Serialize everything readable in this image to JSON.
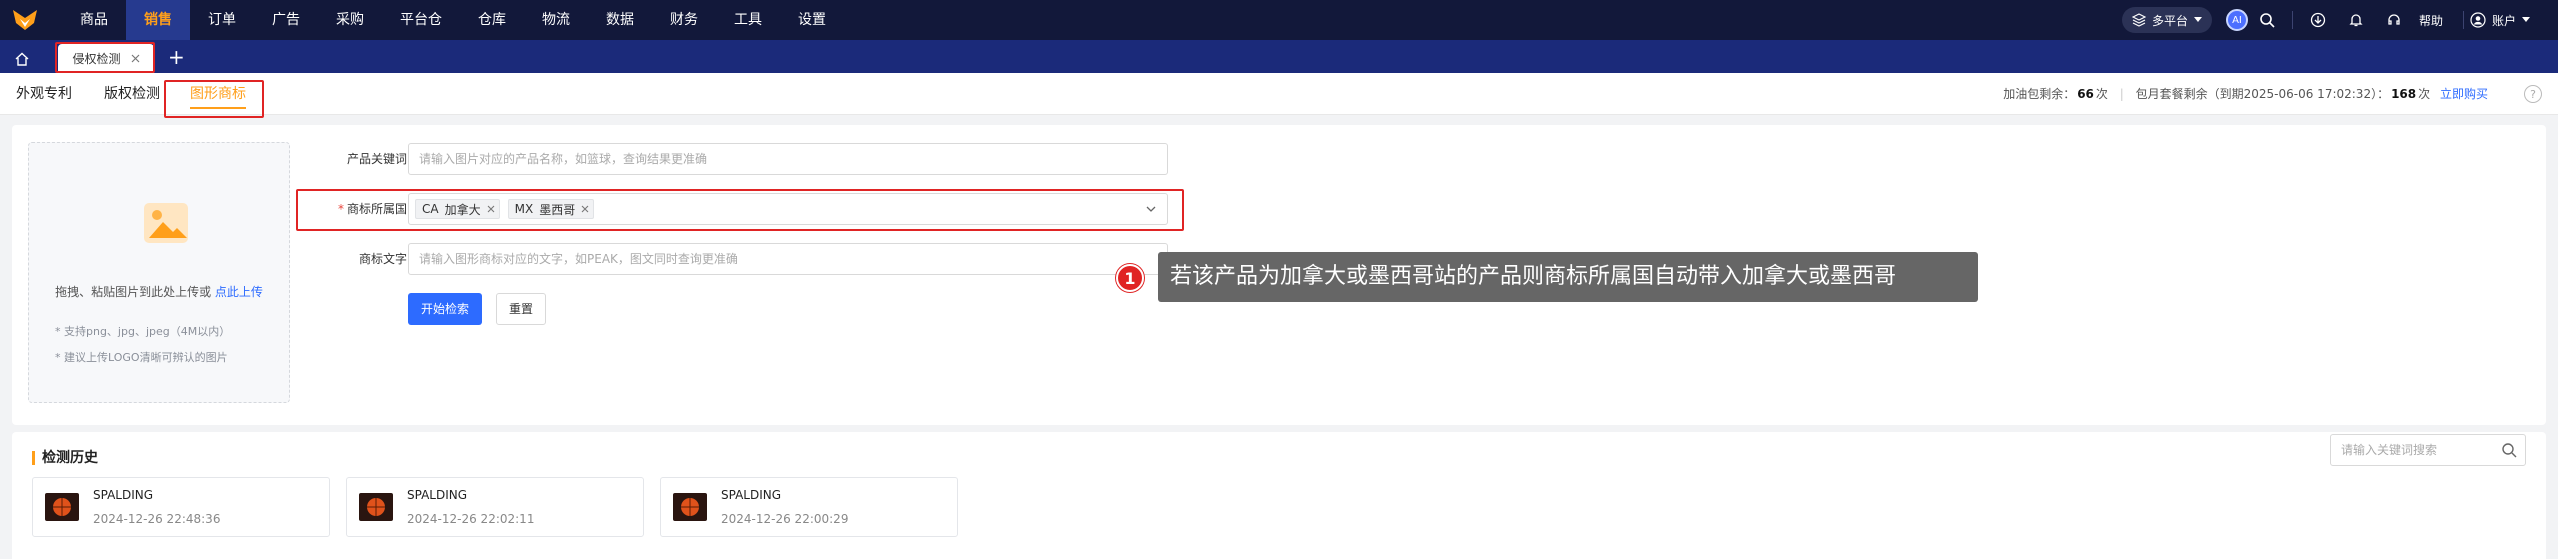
{
  "nav": {
    "items": [
      "商品",
      "销售",
      "订单",
      "广告",
      "采购",
      "平台仓",
      "仓库",
      "物流",
      "数据",
      "财务",
      "工具",
      "设置"
    ],
    "active_index": 1,
    "platform_label": "多平台",
    "ai_label": "AI",
    "help_label": "帮助",
    "account_label": "账户"
  },
  "tabs": {
    "open_tab_label": "侵权检测",
    "add_symbol": "+"
  },
  "subtabs": {
    "items": [
      "外观专利",
      "版权检测",
      "图形商标"
    ],
    "active_index": 2
  },
  "quota": {
    "fuel_label": "加油包剩余：",
    "fuel_value": "66",
    "fuel_unit": "次",
    "plan_label": "包月套餐剩余（到期2025-06-06 17:02:32）：",
    "plan_value": "168",
    "plan_unit": "次",
    "buy_label": "立即购买"
  },
  "upload": {
    "main_text": "拖拽、粘贴图片到此处上传或 ",
    "link_text": "点此上传",
    "tip1": "* 支持png、jpg、jpeg（4M以内）",
    "tip2": "* 建议上传LOGO清晰可辨认的图片"
  },
  "form": {
    "keyword_label": "产品关键词",
    "keyword_placeholder": "请输入图片对应的产品名称，如篮球，查询结果更准确",
    "country_label": "商标所属国",
    "country_required": "*",
    "country_tags": [
      {
        "code": "CA",
        "name": "加拿大"
      },
      {
        "code": "MX",
        "name": "墨西哥"
      }
    ],
    "text_label": "商标文字",
    "text_placeholder": "请输入图形商标对应的文字，如PEAK，图文同时查询更准确",
    "start_button": "开始检索",
    "reset_button": "重置"
  },
  "callout": {
    "number": "1",
    "text": "若该产品为加拿大或墨西哥站的产品则商标所属国自动带入加拿大或墨西哥"
  },
  "history": {
    "title": "检测历史",
    "search_placeholder": "请输入关键词搜索",
    "items": [
      {
        "name": "SPALDING",
        "time": "2024-12-26 22:48:36"
      },
      {
        "name": "SPALDING",
        "time": "2024-12-26 22:02:11"
      },
      {
        "name": "SPALDING",
        "time": "2024-12-26 22:00:29"
      }
    ]
  },
  "colors": {
    "nav_bg": "#12183a",
    "tabstrip_bg": "#1b2a7a",
    "accent_orange": "#ff9f1a",
    "primary_blue": "#2d6bff",
    "highlight_red": "#e02424"
  }
}
